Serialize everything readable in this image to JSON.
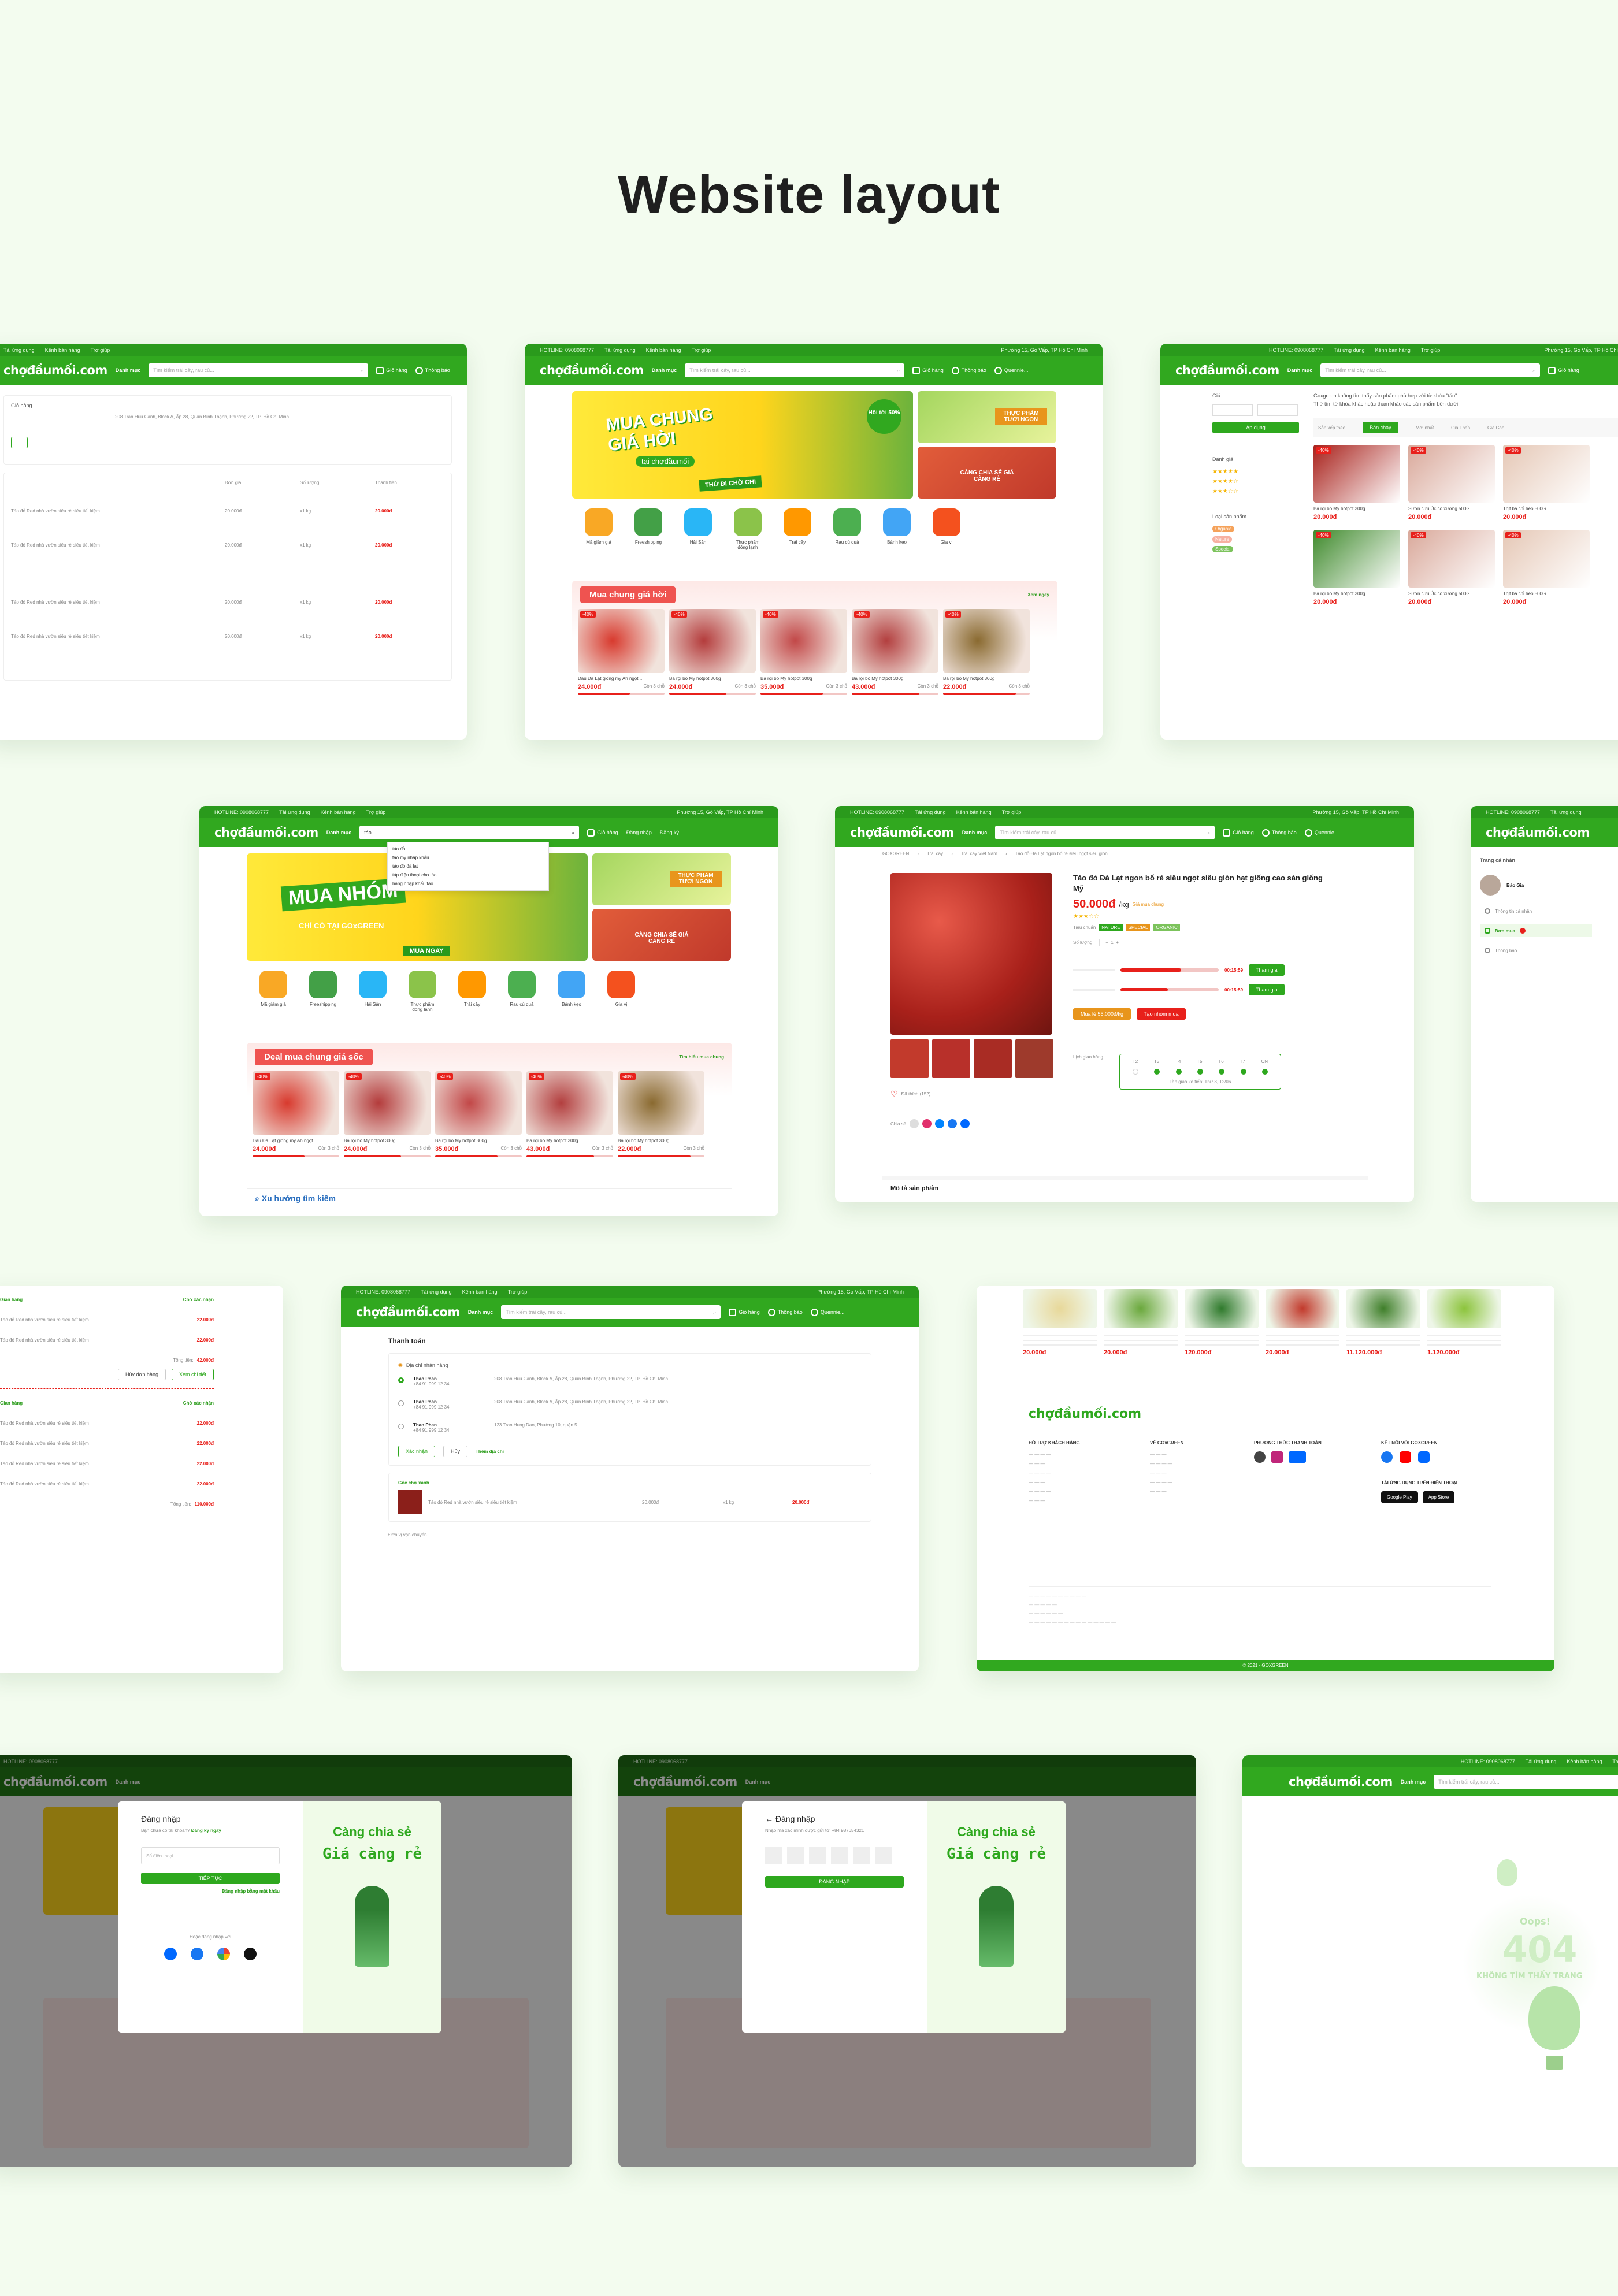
{
  "page": {
    "title": "Website layout"
  },
  "brand": {
    "logo": "chợđầumối.com",
    "green": "#31a81f",
    "red": "#e8201b"
  },
  "topbar": {
    "hotline": "HOTLINE: 0908068777",
    "links": [
      "Tải ứng dụng",
      "Kênh bán hàng",
      "Trợ giúp"
    ],
    "location": "Phường 15, Gò Vấp, TP Hồ Chí Minh"
  },
  "header": {
    "category": "Danh mục",
    "search_placeholder": "Tìm kiếm trái cây, rau củ...",
    "cart": "Giỏ hàng",
    "notify": "Thông báo",
    "user": "Quennie...",
    "login": "Đăng nhập",
    "register": "Đăng ký"
  },
  "categories": [
    "Mã giảm giá",
    "Freeshipping",
    "Hải Sản",
    "Thực phẩm đông lạnh",
    "Trái cây",
    "Rau củ quả",
    "Bánh kẹo",
    "Gia vị"
  ],
  "home": {
    "banner_main": "MUA CHUNG GIÁ HỜI",
    "banner_sub": "tại chợđầumối",
    "banner_cta": "THỬ ĐI CHỜ CHI",
    "banner_badge": "Hôi tới 50%",
    "side_top": "THỰC PHẨM TƯƠI NGON",
    "side_bottom": "CÀNG CHIA SẺ GIÁ CÀNG RẺ",
    "section": "Mua chung giá hời",
    "see_all": "Xem ngay"
  },
  "home2": {
    "banner_main": "MUA NHÓM",
    "banner_sub": "CHỈ CÓ TẠI GOxGREEN",
    "banner_cta": "MUA NGAY",
    "section": "Deal mua chung giá sốc",
    "see_all": "Tìm hiểu mua chung",
    "trend": "Xu hướng tìm kiếm",
    "search_value": "táo",
    "suggestions": [
      "táo đỏ",
      "táo mỹ nhập khẩu",
      "táo đỏ đà lạt",
      "táp điện thoại cho táo",
      "hàng nhập khẩu táo"
    ]
  },
  "products": [
    {
      "name": "Dâu Đà Lạt giống mỹ Ah ngọt...",
      "price": "24.000đ",
      "left": "Còn 3 chỗ",
      "color": "#d83a2e"
    },
    {
      "name": "Ba rọi bò Mỹ hotpot 300g",
      "price": "24.000đ",
      "left": "Còn 3 chỗ",
      "color": "#b43c3c"
    },
    {
      "name": "Ba rọi bò Mỹ hotpot 300g",
      "price": "35.000đ",
      "left": "Còn 3 chỗ",
      "color": "#c24848"
    },
    {
      "name": "Ba rọi bò Mỹ hotpot 300g",
      "price": "43.000đ",
      "left": "Còn 3 chỗ",
      "color": "#b33f3f"
    },
    {
      "name": "Ba rọi bò Mỹ hotpot 300g",
      "price": "22.000đ",
      "left": "Còn 3 chỗ",
      "color": "#8a6a30"
    }
  ],
  "cart": {
    "title": "Giỏ hàng",
    "address": "208 Tran Huu Canh, Block A, Ấp 28, Quận Bình Thạnh, Phường 22, TP. Hồ Chí Minh",
    "cols": [
      "Đơn giá",
      "Số lượng",
      "Thành tiền"
    ],
    "item": "Táo đỏ Red nhà vườn siêu rẻ siêu tiết kiệm",
    "unit": "20.000đ",
    "qty": "x1 kg",
    "total": "20.000đ"
  },
  "search_page": {
    "filter_price": "Giá",
    "apply": "Áp dụng",
    "rating": "Đánh giá",
    "type": "Loại sản phẩm",
    "types": [
      "Organic",
      "Nature",
      "Special"
    ],
    "empty_text": "Goxgreen không tìm thấy sản phẩm phù hợp với từ khóa \"táo\"",
    "hint": "Thử tìm từ khóa khác hoặc tham khảo các sản phẩm bên dưới",
    "sort": "Sắp xếp theo",
    "sorts": [
      "Bán chạy",
      "Mới nhất",
      "Giá Thấp",
      "Giá Cao"
    ],
    "items": [
      "Ba rọi bò Mỹ hotpot 300g",
      "Sườn cừu Úc có xương 500G",
      "Thịt ba chỉ heo 500G",
      "Ba rọi bò Mỹ hotpot 300g",
      "Sườn cừu Úc có xương 500G",
      "Thịt ba chỉ heo 500G"
    ],
    "price": "20.000đ"
  },
  "detail": {
    "crumbs": [
      "GOXGREEN",
      "Trái cây",
      "Trái cây Việt Nam",
      "Táo đỏ Đà Lạt ngon bổ rẻ siêu ngọt siêu giòn"
    ],
    "name": "Táo đỏ Đà Lạt ngon bổ rẻ siêu ngọt siêu giòn hạt giống cao sản giống Mỹ",
    "price": "50.000đ",
    "unit": "/kg",
    "group_label": "Giá mua chung",
    "standard": "Tiêu chuẩn",
    "badges": [
      "NATURE",
      "SPECIAL",
      "ORGANIC"
    ],
    "qty_label": "Số lượng",
    "join": "Tham gia",
    "buy_now": "Mua lẻ 55.000đ/kg",
    "create_group": "Tạo nhóm mua",
    "schedule": "Lịch giao hàng",
    "days": [
      "T2",
      "T3",
      "T4",
      "T5",
      "T6",
      "T7",
      "CN"
    ],
    "next": "Lần giao kế tiếp: Thứ 3, 12/06",
    "share": "Chia sẻ",
    "liked": "Đã thích (152)",
    "desc": "Mô tả sản phẩm"
  },
  "account": {
    "title": "Trang cá nhân",
    "name": "Bảo Gia",
    "items": [
      "Thông tin cá nhân",
      "Đơn mua",
      "Thông báo"
    ]
  },
  "orders": {
    "shop": "Gian hàng",
    "status": "Chờ xác nhận",
    "item": "Táo đỏ Red nhà vườn siêu rẻ siêu tiết kiệm",
    "price": "22.000đ",
    "total_label": "Tổng tiền:",
    "total": "42.000đ",
    "total2": "110.000đ",
    "cancel": "Hủy đơn hàng",
    "view": "Xem chi tiết"
  },
  "checkout": {
    "title": "Thanh toán",
    "addr_title": "Địa chỉ nhận hàng",
    "people": [
      {
        "name": "Thao Phan",
        "phone": "+84 91 999 12 34",
        "addr": "208 Tran Huu Canh, Block A, Ấp 28, Quận Bình Thạnh, Phường 22, TP. Hồ Chí Minh"
      },
      {
        "name": "Thao Phan",
        "phone": "+84 91 999 12 34",
        "addr": "208 Tran Huu Canh, Block A, Ấp 28, Quận Bình Thạnh, Phường 22, TP. Hồ Chí Minh"
      },
      {
        "name": "Thao Phan",
        "phone": "+84 91 999 12 34",
        "addr": "123 Tran Hung Dao, Phường 10, quận 5"
      }
    ],
    "confirm": "Xác nhận",
    "cancel": "Hủy",
    "add": "Thêm địa chỉ",
    "shop": "Gốc chợ xanh",
    "item": "Táo đỏ Red nhà vườn siêu rẻ siêu tiết kiệm",
    "unit": "20.000đ",
    "qty": "x1 kg",
    "total": "20.000đ",
    "ship": "Đơn vị vận chuyển"
  },
  "footer": {
    "support": "HỖ TRỢ KHÁCH HÀNG",
    "about": "VỀ GOxGREEN",
    "pay": "PHƯƠNG THỨC THANH TOÁN",
    "connect": "KẾT NỐI VỚI GOXGREEN",
    "app": "TẢI ỨNG DỤNG TRÊN ĐIỆN THOẠI",
    "google": "Google Play",
    "apple": "App Store",
    "copyright": "© 2021 - GOXGREEN",
    "fruit_prices": [
      "20.000đ",
      "20.000đ",
      "120.000đ",
      "20.000đ",
      "11.120.000đ",
      "1.120.000đ"
    ]
  },
  "login": {
    "title": "Đăng nhập",
    "no_account": "Bạn chưa có tài khoản?",
    "register_now": "Đăng ký ngay",
    "phone_placeholder": "Số điện thoại",
    "next": "TIẾP TỤC",
    "other": "Đăng nhập bằng mật khẩu",
    "or": "Hoặc đăng nhập với",
    "otp_title": "Đăng nhập",
    "otp_hint": "Nhập mã xác minh được gửi tới +84 987654321",
    "otp_btn": "ĐĂNG NHẬP",
    "slogan1": "Càng chia sẻ",
    "slogan2": "Giá càng rẻ"
  },
  "notfound": {
    "oops": "Oops!",
    "code": "404",
    "msg": "KHÔNG TÌM THẤY TRANG"
  }
}
